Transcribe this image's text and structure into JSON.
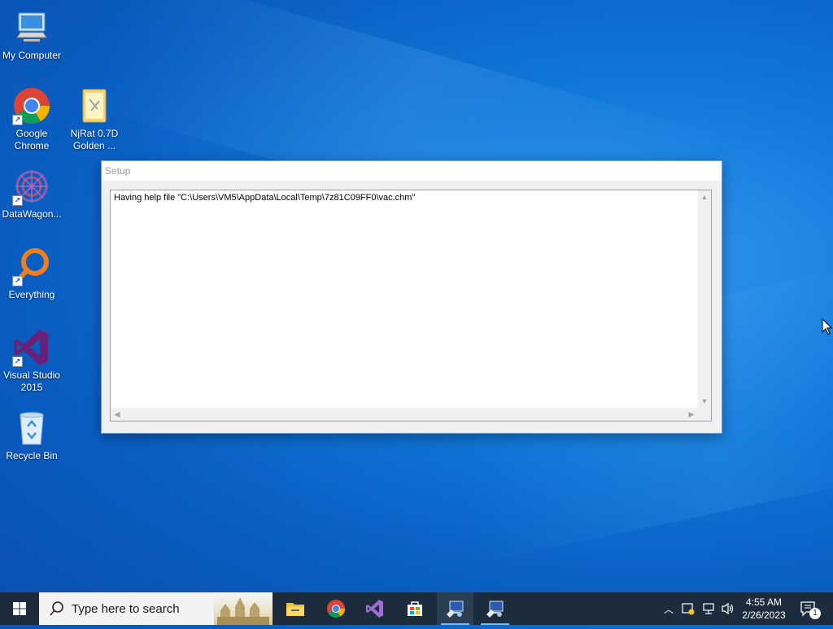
{
  "desktop": {
    "icons": [
      {
        "label": "My Computer",
        "icon": "computer-icon"
      },
      {
        "label": "Google Chrome",
        "icon": "chrome-icon"
      },
      {
        "label": "NjRat 0.7D Golden ...",
        "icon": "folder-icon"
      },
      {
        "label": "DataWagon...",
        "icon": "datawagon-icon"
      },
      {
        "label": "Everything",
        "icon": "everything-search-icon"
      },
      {
        "label": "Visual Studio 2015",
        "icon": "visual-studio-icon"
      },
      {
        "label": "Recycle Bin",
        "icon": "recycle-bin-icon"
      }
    ]
  },
  "window": {
    "title": "Setup",
    "content": "Having help file \"C:\\Users\\VM5\\AppData\\Local\\Temp\\7z81C09FF0\\vac.chm\""
  },
  "taskbar": {
    "search_placeholder": "Type here to search",
    "pinned": [
      "file-explorer-icon",
      "chrome-icon",
      "visual-studio-icon",
      "microsoft-store-icon",
      "setup-app-icon",
      "setup-app-icon"
    ],
    "clock": {
      "time": "4:55 AM",
      "date": "2/26/2023"
    },
    "notification_count": "1",
    "accent_color": "#7ab8ef"
  },
  "colors": {
    "desktop_blue": "#0f78d8",
    "taskbar_bg": "#1c2c3c"
  }
}
